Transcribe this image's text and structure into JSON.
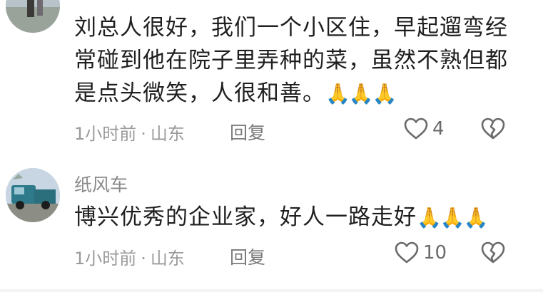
{
  "comments": [
    {
      "username": "",
      "text": "刘总人很好，我们一个小区住，早起遛弯经常碰到他在院子里弄种的菜，虽然不熟但都是点头微笑，人很和善。",
      "emoji": "🙏🙏🙏",
      "time": "1小时前",
      "location": "山东",
      "separator": "·",
      "reply_label": "回复",
      "like_count": "4"
    },
    {
      "username": "纸风车",
      "text": "博兴优秀的企业家，好人一路走好",
      "emoji": "🙏🙏🙏",
      "time": "1小时前",
      "location": "山东",
      "separator": "·",
      "reply_label": "回复",
      "like_count": "10"
    }
  ],
  "colors": {
    "text": "#1f1f1f",
    "username": "#8a8a8a",
    "meta": "#9a9a9a",
    "icon": "#6a6a6a"
  },
  "icons": [
    "heart-outline-icon",
    "broken-heart-icon",
    "pray-hands-emoji"
  ]
}
